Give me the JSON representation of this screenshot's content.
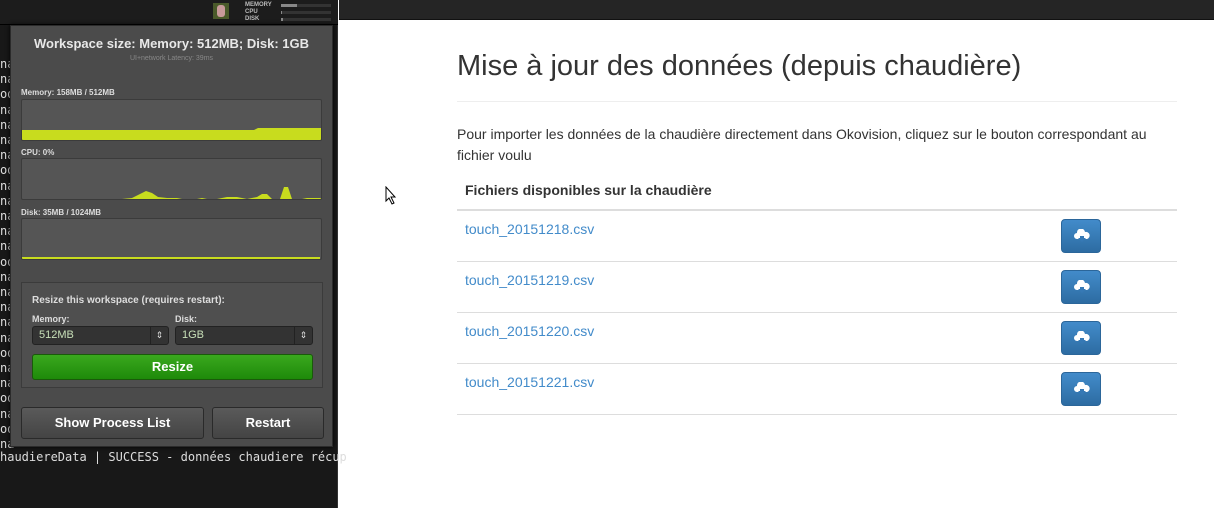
{
  "topbar": {
    "stats": [
      {
        "label": "MEMORY",
        "fraction": 0.31
      },
      {
        "label": "CPU",
        "fraction": 0.02
      },
      {
        "label": "DISK",
        "fraction": 0.03
      }
    ]
  },
  "terminal": {
    "left_fragments": [
      "na",
      "na",
      "od",
      "na",
      "na",
      "na",
      "na",
      "od",
      "na",
      "na",
      "na",
      "na",
      "na",
      "od",
      "na",
      "na",
      "na",
      "na",
      "na",
      "od",
      "na",
      "na",
      "od",
      "na",
      "od",
      "na"
    ],
    "last_line": "haudiereData | SUCCESS - données chaudiere récup"
  },
  "workspace": {
    "title": "Workspace size: Memory: 512MB; Disk: 1GB",
    "latency": "UI+network Latency: 39ms",
    "memory_label": "Memory: 158MB / 512MB",
    "cpu_label": "CPU: 0%",
    "disk_label": "Disk: 35MB / 1024MB",
    "resize_title": "Resize this workspace (requires restart):",
    "memory_field_label": "Memory:",
    "memory_value": "512MB",
    "disk_field_label": "Disk:",
    "disk_value": "1GB",
    "resize_button": "Resize",
    "process_list_button": "Show Process List",
    "restart_button": "Restart",
    "accent": "#c8dc1e"
  },
  "page": {
    "title": "Mise à jour des données (depuis chaudière)",
    "intro": "Pour importer les données de la chaudière directement dans Okovision, cliquez sur le bouton correspondant au fichier voulu",
    "table_header": "Fichiers disponibles sur la chaudière",
    "files": [
      "touch_20151218.csv",
      "touch_20151219.csv",
      "touch_20151220.csv",
      "touch_20151221.csv"
    ],
    "download_icon": "cloud-download-icon"
  }
}
